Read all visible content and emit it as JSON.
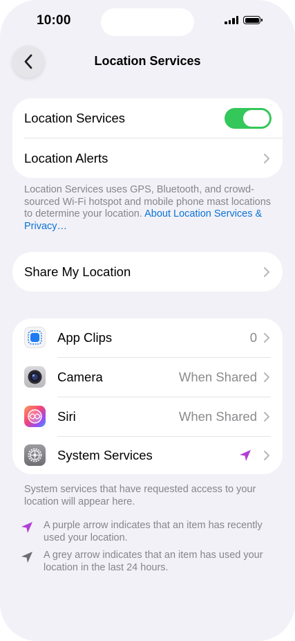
{
  "status_bar": {
    "time": "10:00"
  },
  "nav": {
    "title": "Location Services"
  },
  "main_group": {
    "location_services_label": "Location Services",
    "location_services_enabled": true,
    "location_alerts_label": "Location Alerts"
  },
  "main_footnote": {
    "text": "Location Services uses GPS, Bluetooth, and crowd-sourced Wi-Fi hotspot and mobile phone mast locations to determine your location. ",
    "link": "About Location Services & Privacy…"
  },
  "share_group": {
    "share_label": "Share My Location"
  },
  "apps": [
    {
      "label": "App Clips",
      "value": "0",
      "icon": "app-clips-icon"
    },
    {
      "label": "Camera",
      "value": "When Shared",
      "icon": "camera-icon"
    },
    {
      "label": "Siri",
      "value": "When Shared",
      "icon": "siri-icon"
    },
    {
      "label": "System Services",
      "value": "",
      "icon": "settings-gear-icon",
      "indicator": "purple-location-arrow-icon"
    }
  ],
  "apps_footnote": "System services that have requested access to your location will appear here.",
  "legend": [
    {
      "icon": "purple-location-arrow-icon",
      "text": "A purple arrow indicates that an item has recently used your location."
    },
    {
      "icon": "grey-location-arrow-icon",
      "text": "A grey arrow indicates that an item has used your location in the last 24 hours."
    }
  ],
  "colors": {
    "background": "#f2f1f7",
    "toggle_on": "#34c759",
    "link": "#0a72d8",
    "purple_arrow": "#b23fd6",
    "grey_arrow": "#6d6d72",
    "secondary_text": "#85858b"
  }
}
